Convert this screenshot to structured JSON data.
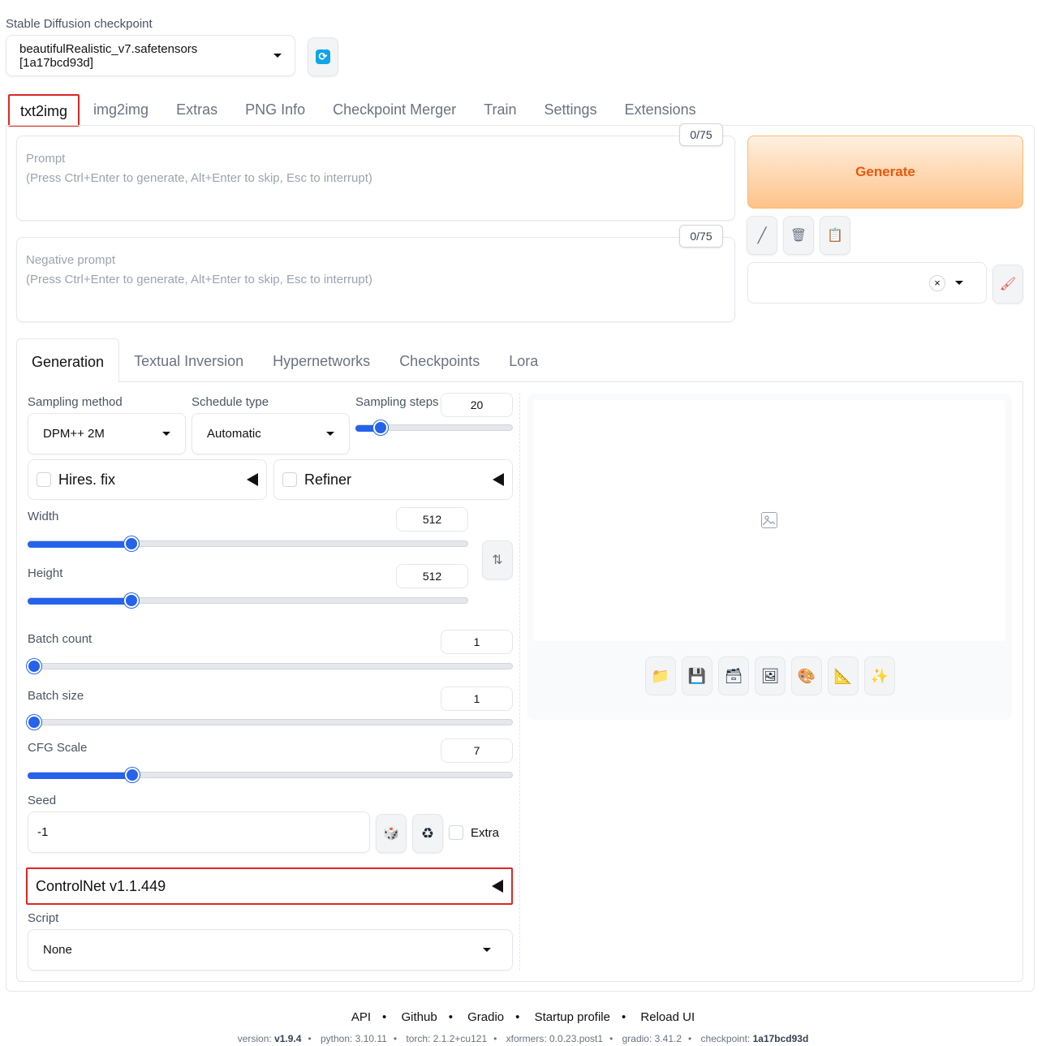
{
  "checkpoint": {
    "label": "Stable Diffusion checkpoint",
    "value": "beautifulRealistic_v7.safetensors [1a17bcd93d]"
  },
  "tabs": [
    "txt2img",
    "img2img",
    "Extras",
    "PNG Info",
    "Checkpoint Merger",
    "Train",
    "Settings",
    "Extensions"
  ],
  "prompt": {
    "placeholder_line1": "Prompt",
    "placeholder_line2": "(Press Ctrl+Enter to generate, Alt+Enter to skip, Esc to interrupt)",
    "token_count": "0/75"
  },
  "negative_prompt": {
    "placeholder_line1": "Negative prompt",
    "placeholder_line2": "(Press Ctrl+Enter to generate, Alt+Enter to skip, Esc to interrupt)",
    "token_count": "0/75"
  },
  "generate_label": "Generate",
  "subtabs": [
    "Generation",
    "Textual Inversion",
    "Hypernetworks",
    "Checkpoints",
    "Lora"
  ],
  "sampling": {
    "method_label": "Sampling method",
    "method_value": "DPM++ 2M",
    "schedule_label": "Schedule type",
    "schedule_value": "Automatic",
    "steps_label": "Sampling steps",
    "steps_value": "20"
  },
  "hires_label": "Hires. fix",
  "refiner_label": "Refiner",
  "width": {
    "label": "Width",
    "value": "512"
  },
  "height": {
    "label": "Height",
    "value": "512"
  },
  "batch_count": {
    "label": "Batch count",
    "value": "1"
  },
  "batch_size": {
    "label": "Batch size",
    "value": "1"
  },
  "cfg_scale": {
    "label": "CFG Scale",
    "value": "7"
  },
  "seed": {
    "label": "Seed",
    "value": "-1",
    "extra_label": "Extra"
  },
  "controlnet_label": "ControlNet v1.1.449",
  "script": {
    "label": "Script",
    "value": "None"
  },
  "footer": {
    "links": [
      "API",
      "Github",
      "Gradio",
      "Startup profile",
      "Reload UI"
    ],
    "version_key": "version:",
    "version": "v1.9.4",
    "python": "python: 3.10.11",
    "torch": "torch: 2.1.2+cu121",
    "xformers": "xformers: 0.0.23.post1",
    "gradio": "gradio: 3.41.2",
    "checkpoint_key": "checkpoint:",
    "checkpoint": "1a17bcd93d"
  },
  "colors": {
    "accent": "#2563eb",
    "highlight": "#dc2626",
    "generate": "#ea580c"
  }
}
